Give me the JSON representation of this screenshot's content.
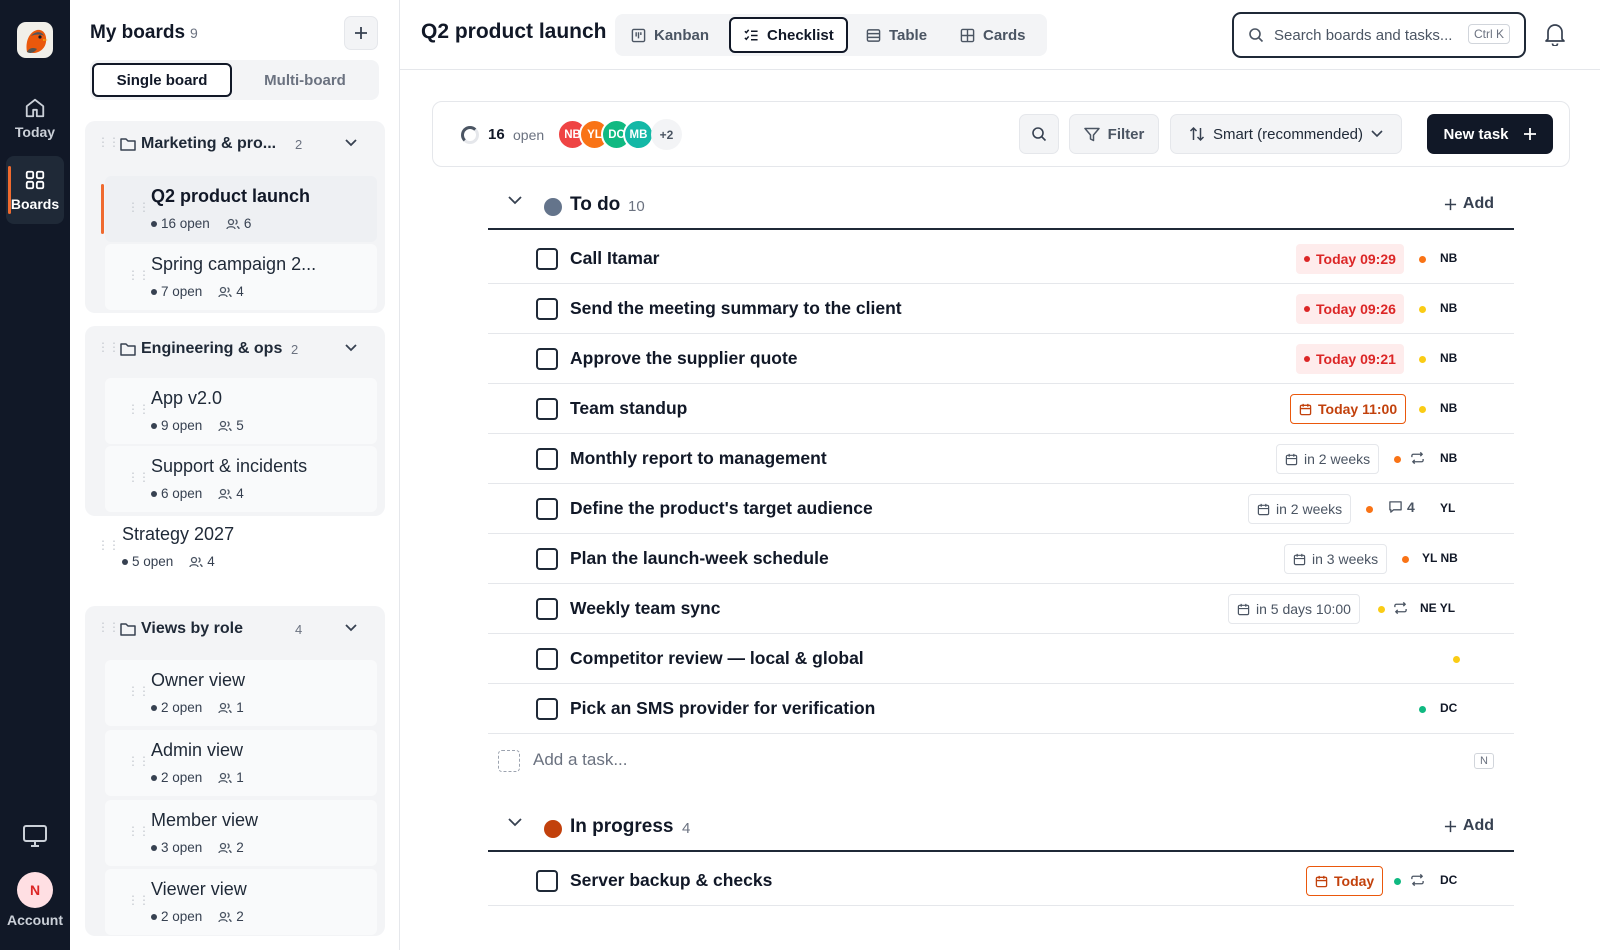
{
  "rail": {
    "today_label": "Today",
    "boards_label": "Boards",
    "account_label": "Account",
    "account_initial": "N"
  },
  "sidebar": {
    "title": "My boards",
    "count": "9",
    "mode_single": "Single board",
    "mode_multi": "Multi-board",
    "groups": [
      {
        "name": "Marketing & pro...",
        "count": "2",
        "boards": [
          {
            "name": "Q2 product launch",
            "open": "16 open",
            "members": "6"
          },
          {
            "name": "Spring campaign 2...",
            "open": "7 open",
            "members": "4"
          }
        ]
      },
      {
        "name": "Engineering & ops",
        "count": "2",
        "boards": [
          {
            "name": "App v2.0",
            "open": "9 open",
            "members": "5"
          },
          {
            "name": "Support & incidents",
            "open": "6 open",
            "members": "4"
          }
        ]
      },
      {
        "name": "Views by role",
        "count": "4",
        "boards": [
          {
            "name": "Owner view",
            "open": "2 open",
            "members": "1"
          },
          {
            "name": "Admin view",
            "open": "2 open",
            "members": "1"
          },
          {
            "name": "Member view",
            "open": "3 open",
            "members": "2"
          },
          {
            "name": "Viewer view",
            "open": "2 open",
            "members": "2"
          }
        ]
      }
    ],
    "standalone": {
      "name": "Strategy 2027",
      "open": "5 open",
      "members": "4"
    }
  },
  "header": {
    "title": "Q2 product launch",
    "views": [
      "Kanban",
      "Checklist",
      "Table",
      "Cards"
    ],
    "active_view": "Checklist",
    "search_placeholder": "Search boards and tasks...",
    "search_shortcut": "Ctrl K"
  },
  "toolbar": {
    "open_count": "16",
    "open_label": "open",
    "avatars": [
      {
        "initials": "NB",
        "color": "#ef4444"
      },
      {
        "initials": "YL",
        "color": "#f97316"
      },
      {
        "initials": "DC",
        "color": "#10b981"
      },
      {
        "initials": "MB",
        "color": "#14b8a6"
      }
    ],
    "more_avatars": "+2",
    "filter_label": "Filter",
    "sort_label": "Smart (recommended)",
    "new_task_label": "New task"
  },
  "sections": [
    {
      "name": "To do",
      "count": "10",
      "color": "#64748b",
      "add_label": "Add",
      "tasks": [
        {
          "title": "Call Itamar",
          "due": "Today 09:29",
          "due_style": "red",
          "priority": "#f97316",
          "assignees": "NB"
        },
        {
          "title": "Send the meeting summary to the client",
          "due": "Today 09:26",
          "due_style": "red",
          "priority": "#facc15",
          "assignees": "NB"
        },
        {
          "title": "Approve the supplier quote",
          "due": "Today 09:21",
          "due_style": "red",
          "priority": "#facc15",
          "assignees": "NB"
        },
        {
          "title": "Team standup",
          "due": "Today 11:00",
          "due_style": "orange",
          "priority": "#facc15",
          "assignees": "NB"
        },
        {
          "title": "Monthly report to management",
          "due": "in 2 weeks",
          "due_style": "gray",
          "priority": "#f97316",
          "repeat": true,
          "assignees": "NB"
        },
        {
          "title": "Define the product's target audience",
          "due": "in 2 weeks",
          "due_style": "gray",
          "priority": "#f97316",
          "comments": "4",
          "assignees": "YL"
        },
        {
          "title": "Plan the launch-week schedule",
          "due": "in 3 weeks",
          "due_style": "gray",
          "priority": "#f97316",
          "assignees": "YL NB"
        },
        {
          "title": "Weekly team sync",
          "due": "in 5 days 10:00",
          "due_style": "gray",
          "priority": "#facc15",
          "repeat": true,
          "assignees": "NE YL"
        },
        {
          "title": "Competitor review — local & global",
          "priority": "#facc15",
          "assignees": ""
        },
        {
          "title": "Pick an SMS provider for verification",
          "priority": "#10b981",
          "assignees": "DC"
        }
      ],
      "add_task_placeholder": "Add a task...",
      "add_task_shortcut": "N"
    },
    {
      "name": "In progress",
      "count": "4",
      "color": "#c2410c",
      "add_label": "Add",
      "tasks": [
        {
          "title": "Server backup & checks",
          "due": "Today",
          "due_style": "orange",
          "priority": "#10b981",
          "repeat": true,
          "assignees": "DC"
        }
      ]
    }
  ]
}
